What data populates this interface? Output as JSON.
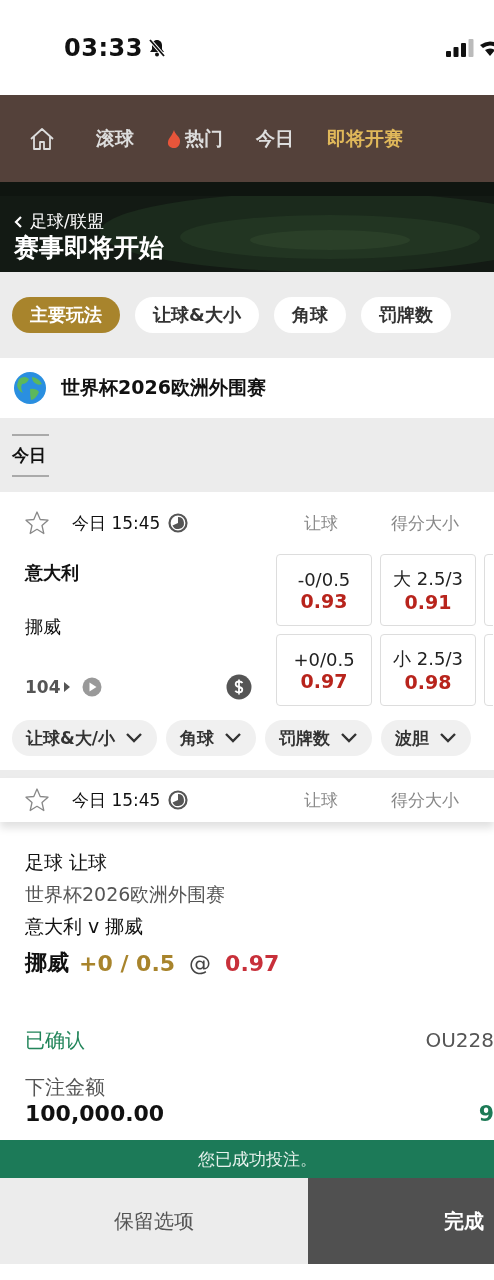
{
  "status_bar": {
    "time": "03:33"
  },
  "nav": [
    {
      "kind": "home",
      "selected": false
    },
    {
      "kind": "text",
      "label": "滚球",
      "selected": false
    },
    {
      "kind": "hot",
      "label": "热门",
      "selected": false
    },
    {
      "kind": "text",
      "label": "今日",
      "selected": false
    },
    {
      "kind": "text",
      "label": "即将开赛",
      "selected": true
    }
  ],
  "banner": {
    "breadcrumb": "足球/联盟",
    "title": "赛事即将开始"
  },
  "market_tabs": [
    {
      "label": "主要玩法",
      "selected": true
    },
    {
      "label": "让球&大小",
      "selected": false
    },
    {
      "label": "角球",
      "selected": false
    },
    {
      "label": "罚牌数",
      "selected": false
    }
  ],
  "league": {
    "name": "世界杯2026欧洲外围赛"
  },
  "date_tabs": [
    {
      "label": "今日",
      "selected": true
    }
  ],
  "matches": [
    {
      "favorite": false,
      "time": "今日 15:45",
      "columns": [
        "让球",
        "得分大小"
      ],
      "home": "意大利",
      "away": "挪威",
      "market_count": "104",
      "odds": [
        [
          {
            "line": "-0/0.5",
            "price": "0.93"
          },
          {
            "line": "大 2.5/3",
            "price": "0.91"
          }
        ],
        [
          {
            "line": "+0/0.5",
            "price": "0.97"
          },
          {
            "line": "小 2.5/3",
            "price": "0.98"
          }
        ]
      ],
      "filters": [
        "让球&大/小",
        "角球",
        "罚牌数",
        "波胆"
      ]
    },
    {
      "favorite": false,
      "time": "今日 15:45",
      "columns": [
        "让球",
        "得分大小"
      ]
    }
  ],
  "bet_slip": {
    "market": "足球 让球",
    "league": "世界杯2026欧洲外围赛",
    "fixture": "意大利 v 挪威",
    "selection": "挪威",
    "handicap": "+0 / 0.5",
    "at": "@",
    "price": "0.97",
    "status": "已确认",
    "reference": "OU228",
    "stake_label": "下注金额",
    "stake": "100,000.00",
    "payout": "9"
  },
  "toast": "您已成功投注。",
  "actions": [
    {
      "kind": "secondary",
      "label": "保留选项"
    },
    {
      "kind": "primary",
      "label": "完成"
    }
  ]
}
